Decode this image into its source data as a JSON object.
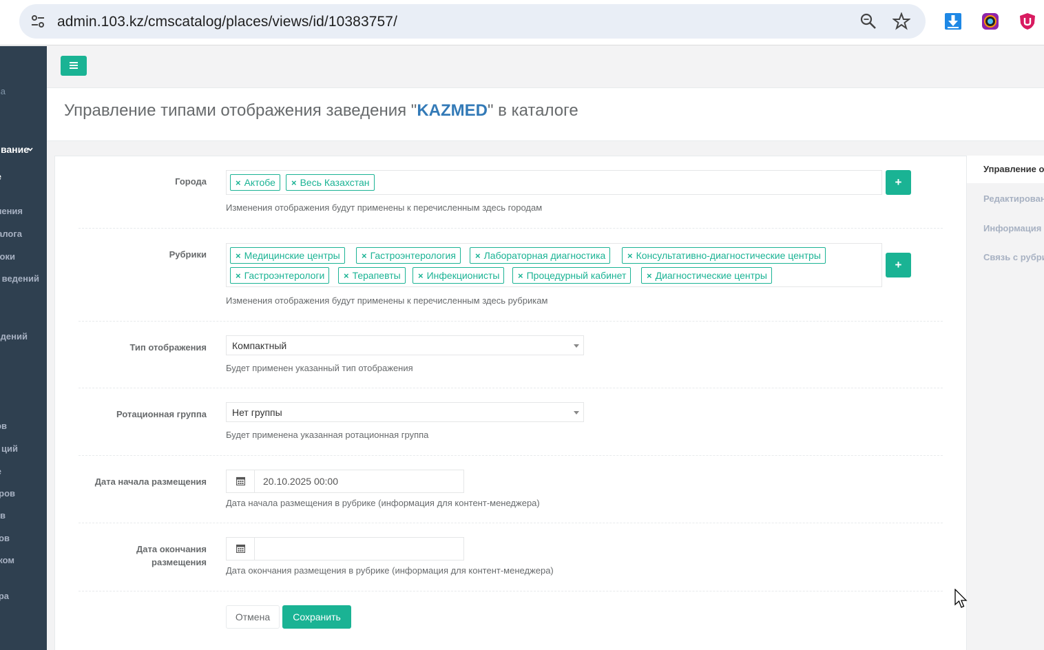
{
  "browser": {
    "url": "admin.103.kz/cmscatalog/places/views/id/10383757/"
  },
  "sidebar": {
    "items": [
      {
        "label": "а"
      },
      {
        "label": "вание"
      },
      {
        "label": "е"
      },
      {
        "label": "ления"
      },
      {
        "label": "алога"
      },
      {
        "label": "оки"
      },
      {
        "label": "ведений"
      },
      {
        "label": "дений"
      },
      {
        "label": "ов"
      },
      {
        "label": "ций"
      },
      {
        "label": "е"
      },
      {
        "label": "ров"
      },
      {
        "label": "в"
      },
      {
        "label": "ов"
      },
      {
        "label": "ком"
      },
      {
        "label": "ра"
      }
    ]
  },
  "heading": {
    "prefix": "Управление типами отображения заведения \"",
    "name": "KAZMED",
    "suffix": "\" в каталоге"
  },
  "form": {
    "cities": {
      "label": "Города",
      "tags": [
        "Актобе",
        "Весь Казахстан"
      ],
      "hint": "Изменения отображения будут применены к перечисленным здесь городам"
    },
    "rubrics": {
      "label": "Рубрики",
      "tags": [
        "Медицинские центры",
        "Гастроэнтерология",
        "Лабораторная диагностика",
        "Консультативно-диагностические центры",
        "Гастроэнтерологи",
        "Терапевты",
        "Инфекционисты",
        "Процедурный кабинет",
        "Диагностические центры"
      ],
      "hint": "Изменения отображения будут применены к перечисленным здесь рубрикам"
    },
    "display_type": {
      "label": "Тип отображения",
      "value": "Компактный",
      "hint": "Будет применен указанный тип отображения"
    },
    "rotation_group": {
      "label": "Ротационная группа",
      "value": "Нет группы",
      "hint": "Будет применена указанная ротационная группа"
    },
    "start_date": {
      "label": "Дата начала размещения",
      "value": "20.10.2025 00:00",
      "hint": "Дата начала размещения в рубрике (информация для контент-менеджера)"
    },
    "end_date": {
      "label_line1": "Дата окончания",
      "label_line2": "размещения",
      "value": "",
      "hint": "Дата окончания размещения в рубрике (информация для контент-менеджера)"
    },
    "add_symbol": "+",
    "remove_symbol": "×",
    "cancel_label": "Отмена",
    "save_label": "Сохранить"
  },
  "right_tabs": [
    {
      "label": "Управление о"
    },
    {
      "label": "Редактирован"
    },
    {
      "label": "Информация"
    },
    {
      "label": "Связь с рубри"
    }
  ],
  "colors": {
    "accent": "#1ab394",
    "sidebar": "#2f4050",
    "link": "#337ab7"
  }
}
